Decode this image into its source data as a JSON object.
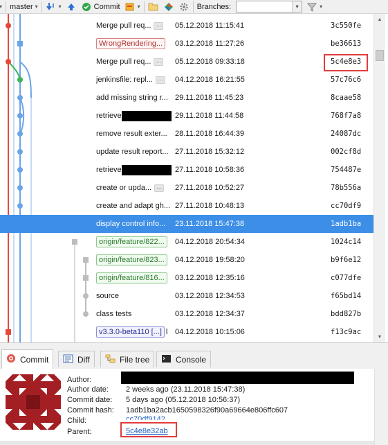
{
  "toolbar": {
    "branch_name": "master",
    "commit_label": "Commit",
    "branches_label": "Branches:",
    "branches_value": ""
  },
  "commits": [
    {
      "message": "Merge pull req...",
      "dots": "···",
      "date": "05.12.2018 11:15:41",
      "hash": "3c550fe"
    },
    {
      "message": "WrongRendering...",
      "tag_style": "red",
      "date": "03.12.2018 11:27:26",
      "hash": "be36613"
    },
    {
      "message": "Merge pull req...",
      "dots": "···",
      "date": "05.12.2018 09:33:18",
      "hash": "5c4e8e3"
    },
    {
      "message": "jenkinsfile: repl...",
      "dots": "···",
      "date": "04.12.2018 16:21:55",
      "hash": "57c76c6"
    },
    {
      "message": "add missing string r...",
      "date": "29.11.2018 11:45:23",
      "hash": "8caae58"
    },
    {
      "message": "retrieve",
      "redacted": true,
      "date": "29.11.2018 11:44:58",
      "hash": "768f7a8"
    },
    {
      "message": "remove result exter...",
      "date": "28.11.2018 16:44:39",
      "hash": "24087dc"
    },
    {
      "message": "update result report...",
      "date": "27.11.2018 15:32:12",
      "hash": "002cf8d"
    },
    {
      "message": "retrieve",
      "redacted": true,
      "date": "27.11.2018 10:58:36",
      "hash": "754487e"
    },
    {
      "message": "create or upda...",
      "dots": "···",
      "date": "27.11.2018 10:52:27",
      "hash": "78b556a"
    },
    {
      "message": "create and adapt gh...",
      "date": "27.11.2018 10:48:13",
      "hash": "cc70df9"
    },
    {
      "message": "display control info...",
      "date": "23.11.2018 15:47:38",
      "hash": "1adb1ba",
      "selected": true
    },
    {
      "message": "origin/feature/822...",
      "tag_style": "green",
      "date": "04.12.2018 20:54:34",
      "hash": "1024c14"
    },
    {
      "message": "origin/feature/823...",
      "tag_style": "green",
      "date": "04.12.2018 19:58:20",
      "hash": "b9f6e12"
    },
    {
      "message": "origin/feature/816...",
      "tag_style": "green",
      "date": "03.12.2018 12:35:16",
      "hash": "c077dfe"
    },
    {
      "message": "source",
      "date": "03.12.2018 12:34:53",
      "hash": "f65bd14"
    },
    {
      "message": "class tests",
      "date": "03.12.2018 12:34:37",
      "hash": "bdd827b"
    },
    {
      "message": "v3.3.0-beta110 [...]",
      "tag_style": "blue",
      "suffix": "l",
      "date": "04.12.2018 10:15:06",
      "hash": "f13c9ac"
    }
  ],
  "tabs": {
    "commit": "Commit",
    "diff": "Diff",
    "file_tree": "File tree",
    "console": "Console"
  },
  "details": {
    "author_label": "Author:",
    "author_date_label": "Author date:",
    "author_date_value": "2 weeks ago (23.11.2018 15:47:38)",
    "commit_date_label": "Commit date:",
    "commit_date_value": "5 days ago (05.12.2018 10:56:37)",
    "commit_hash_label": "Commit hash:",
    "commit_hash_value": "1adb1ba2acb1650598326f90a69664e806ffc607",
    "child_label": "Child:",
    "child_value": "cc70df9142",
    "parent_label": "Parent:",
    "parent_value": "5c4e8e32ab"
  },
  "colors": {
    "selection": "#3d8ee6",
    "highlight_box": "#e03c3c",
    "graph_red": "#e5483a",
    "graph_blue": "#6aa5e6",
    "graph_green": "#3cb55a",
    "graph_gray": "#bdbdbd",
    "link": "#1d5fbf"
  }
}
